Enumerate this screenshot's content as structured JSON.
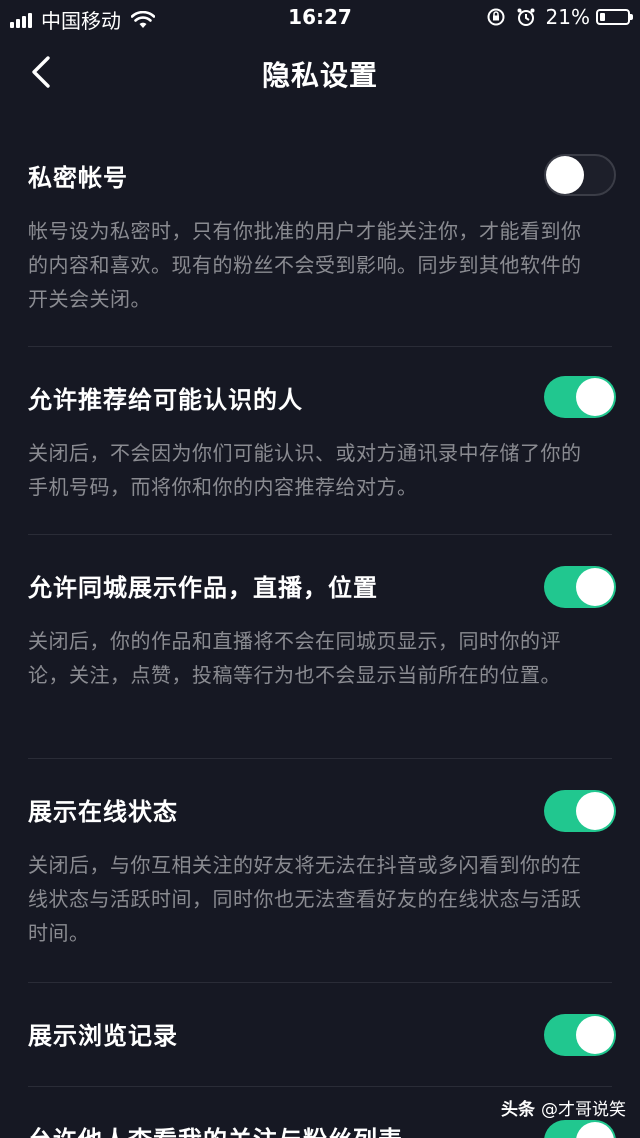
{
  "status_bar": {
    "carrier": "中国移动",
    "time": "16:27",
    "battery_percent": "21%",
    "battery_level": 0.21
  },
  "nav": {
    "back_icon": "chevron-left-icon",
    "title": "隐私设置"
  },
  "settings": [
    {
      "label": "私密帐号",
      "description": "帐号设为私密时，只有你批准的用户才能关注你，才能看到你的内容和喜欢。现有的粉丝不会受到影响。同步到其他软件的开关会关闭。",
      "enabled": false
    },
    {
      "label": "允许推荐给可能认识的人",
      "description": "关闭后，不会因为你们可能认识、或对方通讯录中存储了你的手机号码，而将你和你的内容推荐给对方。",
      "enabled": true
    },
    {
      "label": "允许同城展示作品，直播，位置",
      "description": "关闭后，你的作品和直播将不会在同城页显示，同时你的评论，关注，点赞，投稿等行为也不会显示当前所在的位置。",
      "enabled": true
    },
    {
      "label": "展示在线状态",
      "description": "关闭后，与你互相关注的好友将无法在抖音或多闪看到你的在线状态与活跃时间，同时你也无法查看好友的在线状态与活跃时间。",
      "enabled": true
    },
    {
      "label": "展示浏览记录",
      "description": "",
      "enabled": true
    },
    {
      "label": "允许他人查看我的关注与粉丝列表",
      "description": "",
      "enabled": true
    }
  ],
  "watermark": {
    "source": "头条",
    "author": "@才哥说笑"
  },
  "colors": {
    "background": "#161823",
    "toggle_on": "#21c78f",
    "toggle_off_border": "#3b3d47",
    "description_text": "#8a8b91"
  }
}
